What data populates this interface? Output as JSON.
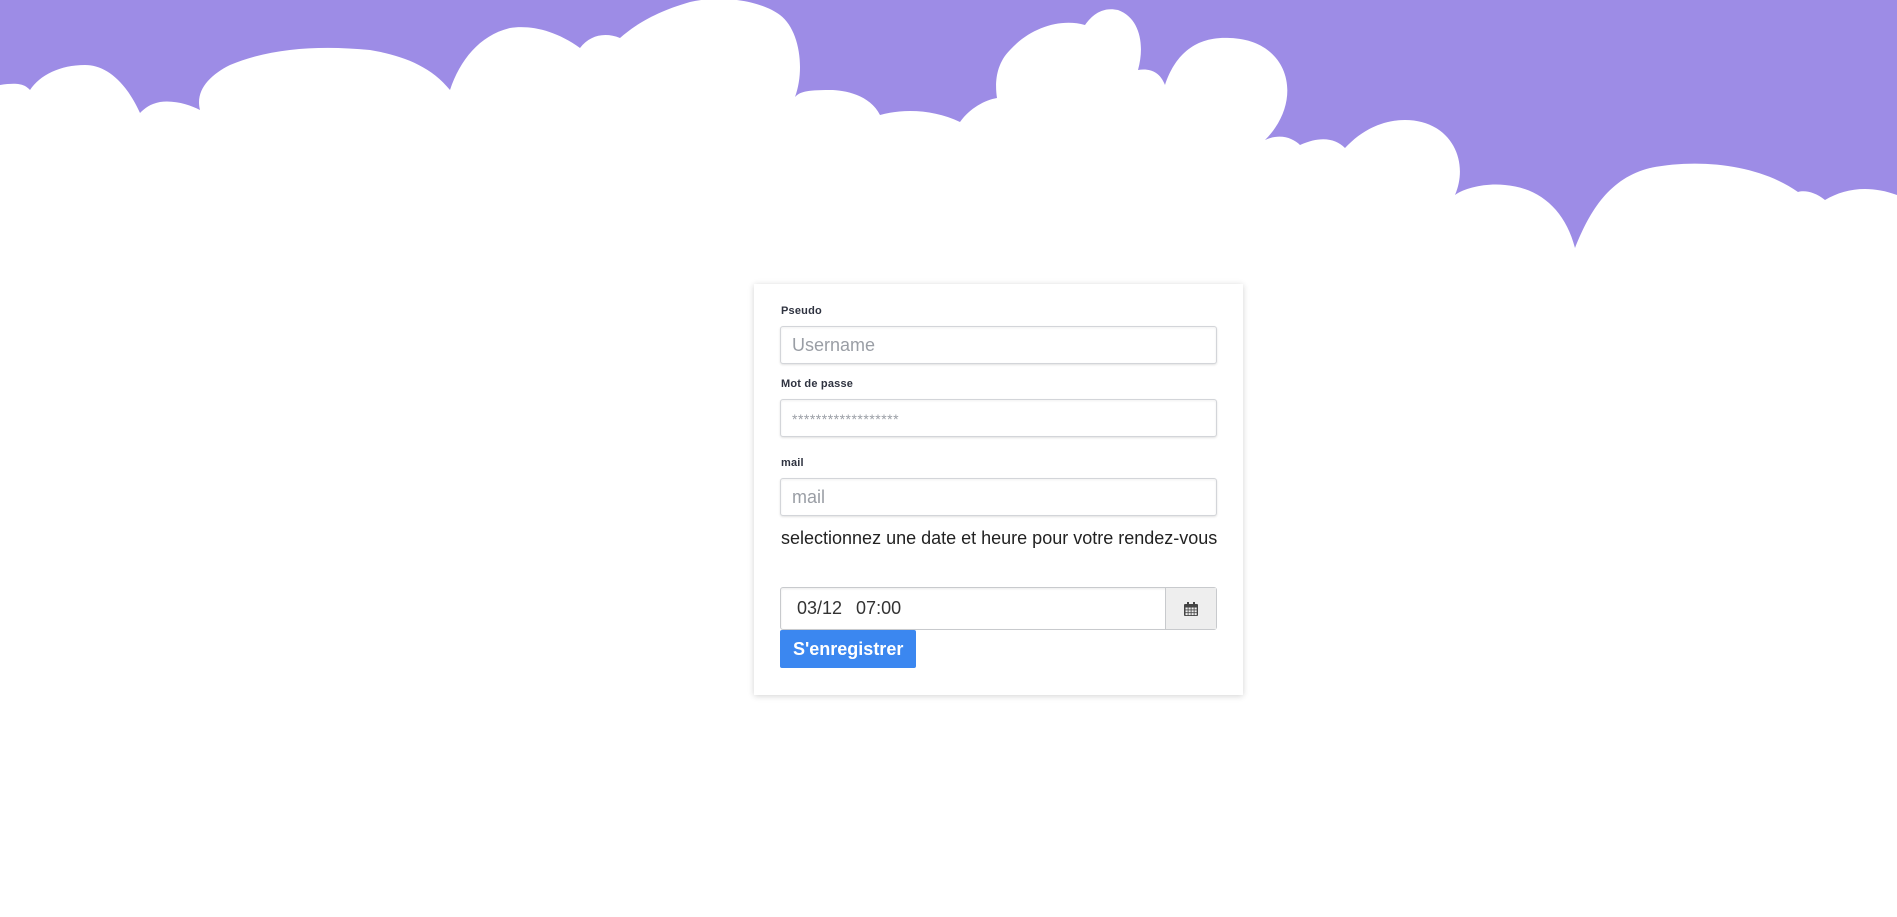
{
  "theme": {
    "sky_color": "#9d8ce6",
    "button_color": "#3b87f0"
  },
  "form": {
    "pseudo_label": "Pseudo",
    "pseudo_placeholder": "Username",
    "password_label": "Mot de passe",
    "password_placeholder": "******************",
    "mail_label": "mail",
    "mail_placeholder": "mail",
    "datetime_help": "selectionnez une date et heure pour votre rendez-vous",
    "date_value": "03/12",
    "time_value": "07:00",
    "calendar_icon": "calendar-icon",
    "submit_label": "S'enregistrer"
  }
}
